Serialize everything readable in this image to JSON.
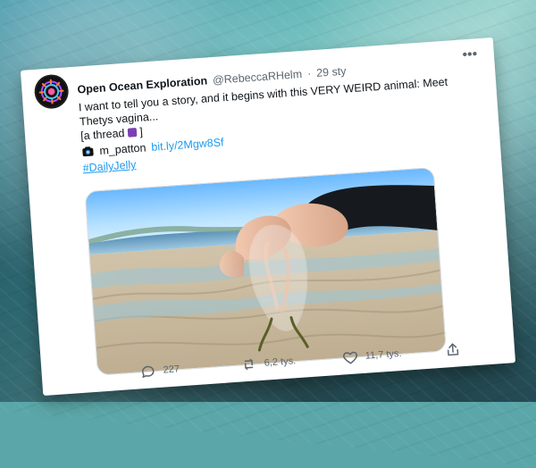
{
  "tweet": {
    "display_name": "Open Ocean Exploration",
    "handle": "@RebeccaRHelm",
    "time": "29 sty",
    "text_lines": [
      "I want to tell you a story, and it begins with this VERY WEIRD animal: Meet",
      "Thetys vagina..."
    ],
    "thread_prefix": "[a thread",
    "thread_suffix": "]",
    "credit_user": "m_patton",
    "credit_link": "bit.ly/2Mgw8Sf",
    "hashtag": "#DailyJelly",
    "actions": {
      "replies": "227",
      "retweets": "6,2 tys.",
      "likes": "11,7 tys."
    }
  },
  "icons": {
    "more": "more-icon",
    "camera": "camera-icon",
    "reply": "reply-icon",
    "retweet": "retweet-icon",
    "like": "like-icon",
    "share": "share-icon"
  },
  "colors": {
    "link": "#1d9bf0",
    "text": "#0f1419",
    "muted": "#5b6670",
    "accent_purple": "#7b3fb3"
  }
}
